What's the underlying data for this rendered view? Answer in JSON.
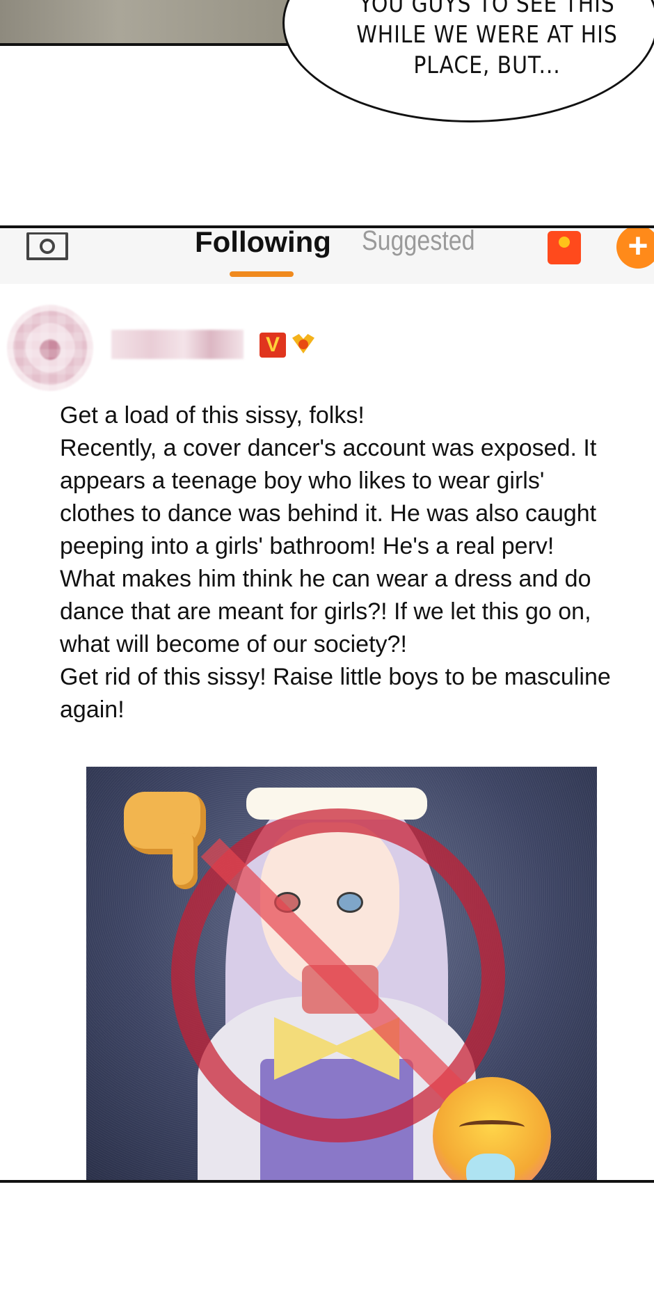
{
  "speech_bubble": {
    "lines": [
      "YOU GUYS TO SEE THIS",
      "WHILE WE WERE AT HIS",
      "PLACE, BUT..."
    ]
  },
  "tabbar": {
    "camera_icon": "camera-icon",
    "tabs": [
      {
        "label": "Following",
        "active": true
      },
      {
        "label": "Suggested",
        "active": false
      }
    ],
    "accent_color": "#f08a1e",
    "red_packet_icon": "red-packet-icon",
    "plus_label": "+"
  },
  "post": {
    "badge_v": "V",
    "paragraphs": [
      "Get a load of this sissy, folks!",
      "Recently, a cover dancer's account was exposed. It appears a teenage boy who likes to wear girls' clothes to dance was behind it. He was also caught peeping into a girls' bathroom! He's a real perv!",
      "What makes him think he can wear a dress and do dance that are meant for girls?! If we let this go on, what will become of our society?!",
      "Get rid of this sissy! Raise little boys to be masculine again!"
    ],
    "image_icons": [
      "thumbs-down-icon",
      "ban-icon",
      "vomit-emoji-icon"
    ]
  }
}
